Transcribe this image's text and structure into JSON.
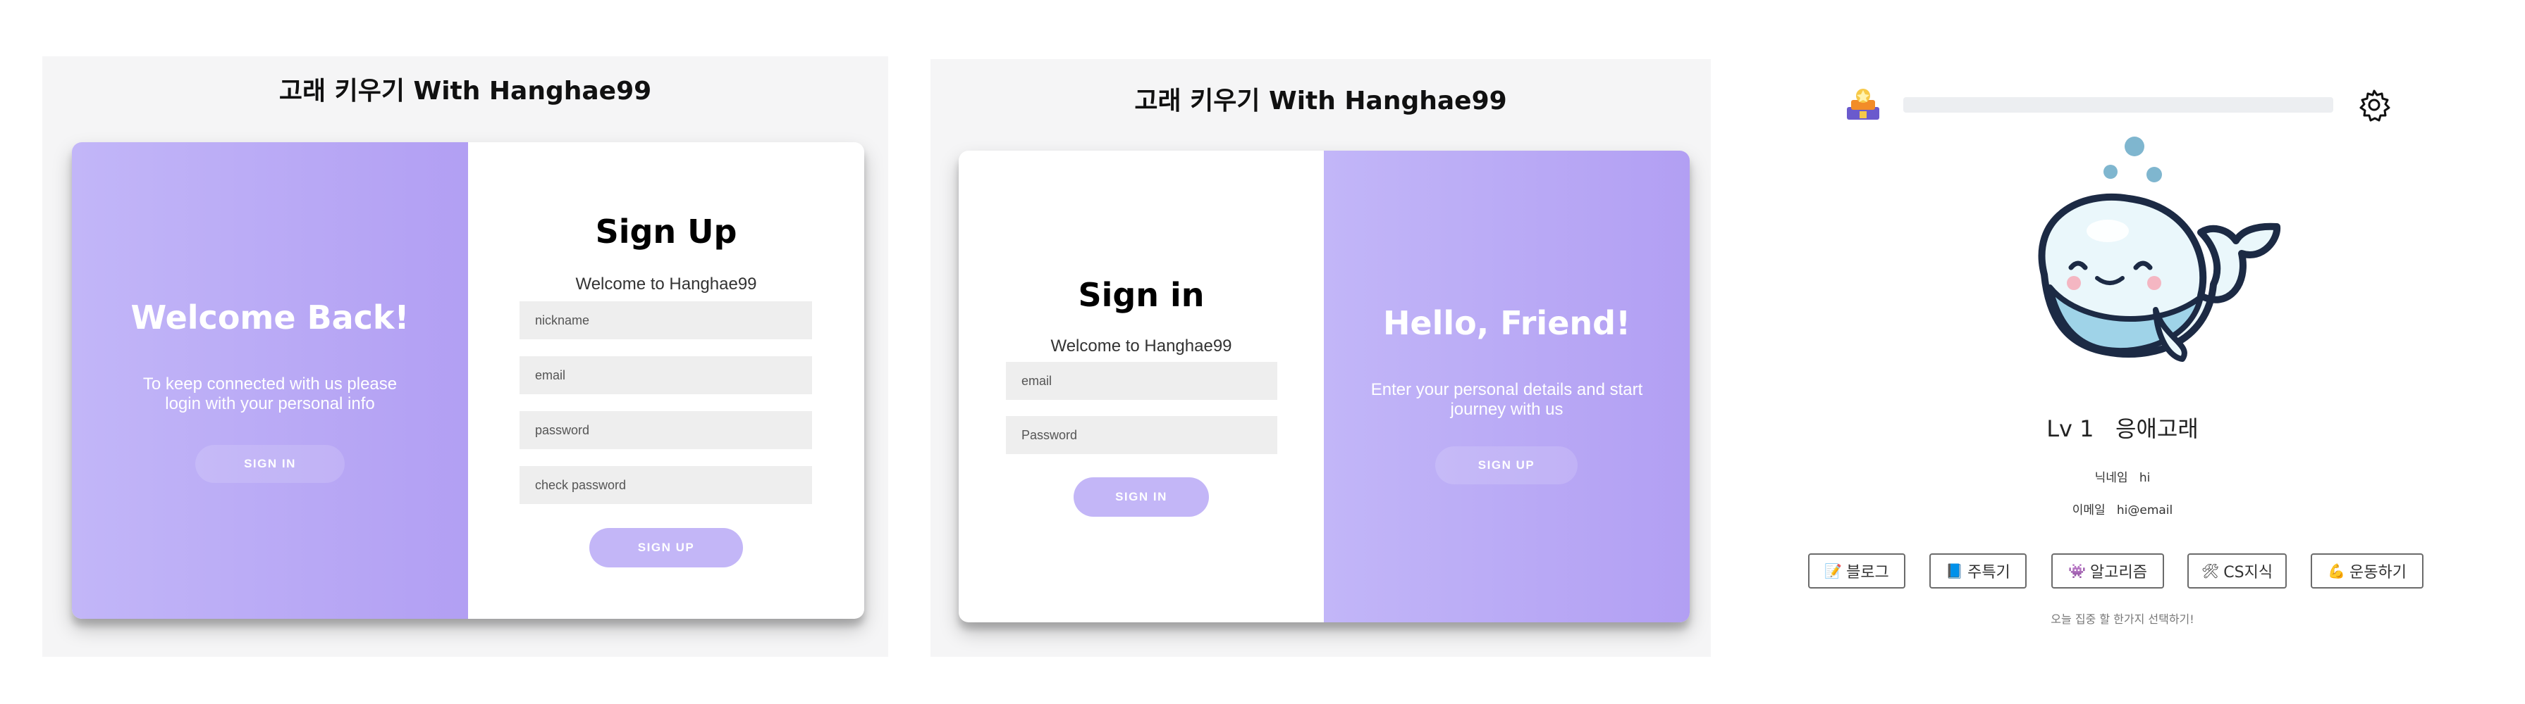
{
  "app_title": "고래 키우기 With Hanghae99",
  "signup_screen": {
    "overlay": {
      "heading": "Welcome Back!",
      "text_line1": "To keep connected with us please",
      "text_line2": "login with your personal info",
      "button": "SIGN IN"
    },
    "form": {
      "heading": "Sign Up",
      "subtitle": "Welcome to Hanghae99",
      "nickname_placeholder": "nickname",
      "email_placeholder": "email",
      "password_placeholder": "password",
      "check_password_placeholder": "check password",
      "submit": "SIGN UP"
    }
  },
  "signin_screen": {
    "form": {
      "heading": "Sign in",
      "subtitle": "Welcome to Hanghae99",
      "email_placeholder": "email",
      "password_placeholder": "Password",
      "submit": "SIGN IN"
    },
    "overlay": {
      "heading": "Hello, Friend!",
      "text_line1": "Enter your personal details and start",
      "text_line2": "journey with us",
      "button": "SIGN UP"
    }
  },
  "profile_screen": {
    "progress": 0,
    "level": "Lv 1",
    "whale_name": "응애고래",
    "nickname_label": "닉네임",
    "nickname_value": "hi",
    "email_label": "이메일",
    "email_value": "hi@email",
    "categories": [
      {
        "emoji": "📝",
        "label": "블로그"
      },
      {
        "emoji": "📘",
        "label": "주특기"
      },
      {
        "emoji": "👾",
        "label": "알고리즘"
      },
      {
        "emoji": "🛠",
        "label": "CS지식"
      },
      {
        "emoji": "💪",
        "label": "운동하기"
      }
    ],
    "footer_hint": "오늘 집중 할 한가지 선택하기!",
    "icons": {
      "top_left": "trophy-icon",
      "top_right": "gear-icon"
    }
  }
}
